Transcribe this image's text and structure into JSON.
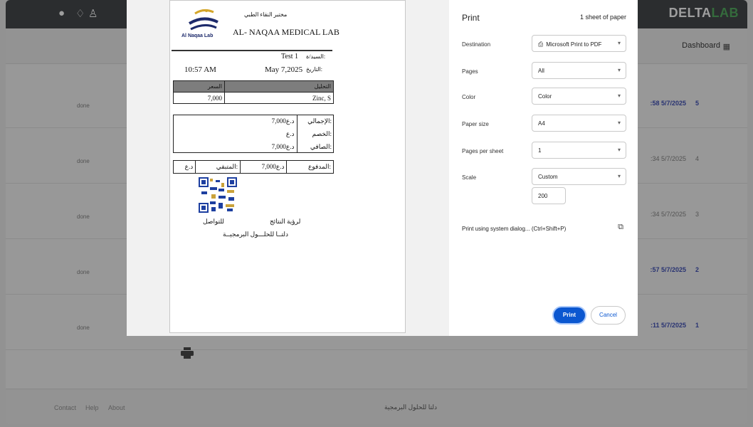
{
  "app": {
    "brand_main": "DELTA",
    "brand_accent": "LAB",
    "dashboard_label": "Dashboard",
    "rows": [
      {
        "status": "done",
        "date": ":58 5/7/2025",
        "num": "5",
        "dim": false
      },
      {
        "status": "done",
        "date": ":34 5/7/2025",
        "num": "4",
        "dim": true
      },
      {
        "status": "done",
        "date": ":34 5/7/2025",
        "num": "3",
        "dim": true
      },
      {
        "status": "done",
        "date": ":57 5/7/2025",
        "num": "2",
        "dim": false
      },
      {
        "status": "done",
        "date": ":11 5/7/2025",
        "num": "1",
        "dim": false
      }
    ],
    "footer": {
      "contact": "Contact",
      "help": "Help",
      "about": "About",
      "tagline": "دلتا للحلول البرمجية"
    }
  },
  "receipt": {
    "logo_text": "Al Naqaa Lab",
    "lab_name_ar": "مختبر النقاء الطبي",
    "lab_name_en": "AL- NAQAA MEDICAL LAB",
    "patient_label": "السيد/ة:",
    "patient_value": "Test 1",
    "date_label": "التاريخ:",
    "date_value": "May 7,2025",
    "time_value": "10:57 AM",
    "items_header_test": "التحليل",
    "items_header_price": "السعر",
    "items": [
      {
        "test": "Zinc, S",
        "price": "7,000"
      }
    ],
    "totals": [
      {
        "label": "الإجمالي:",
        "value": "7,000د.ع"
      },
      {
        "label": "الخصم:",
        "value": "د.ع"
      },
      {
        "label": "الصافي:",
        "value": "7,000د.ع"
      }
    ],
    "paid_label": "المدفوع:",
    "paid_value": "7,000د.ع",
    "remaining_label": "المتبقي:",
    "remaining_value": "د.ع",
    "qr_caption_results": "لرؤية النتائج",
    "qr_caption_contact": "للتواصل",
    "qr_caption_company": "دلتــا للحلـــول البرمجيــة"
  },
  "print": {
    "title": "Print",
    "sheets": "1 sheet of paper",
    "destination_label": "Destination",
    "destination_value": "Microsoft Print to PDF",
    "pages_label": "Pages",
    "pages_value": "All",
    "color_label": "Color",
    "color_value": "Color",
    "paper_size_label": "Paper size",
    "paper_size_value": "A4",
    "pages_per_sheet_label": "Pages per sheet",
    "pages_per_sheet_value": "1",
    "scale_label": "Scale",
    "scale_value": "Custom",
    "scale_custom_value": "200",
    "system_dialog": "Print using system dialog... (Ctrl+Shift+P)",
    "print_button": "Print",
    "cancel_button": "Cancel"
  }
}
